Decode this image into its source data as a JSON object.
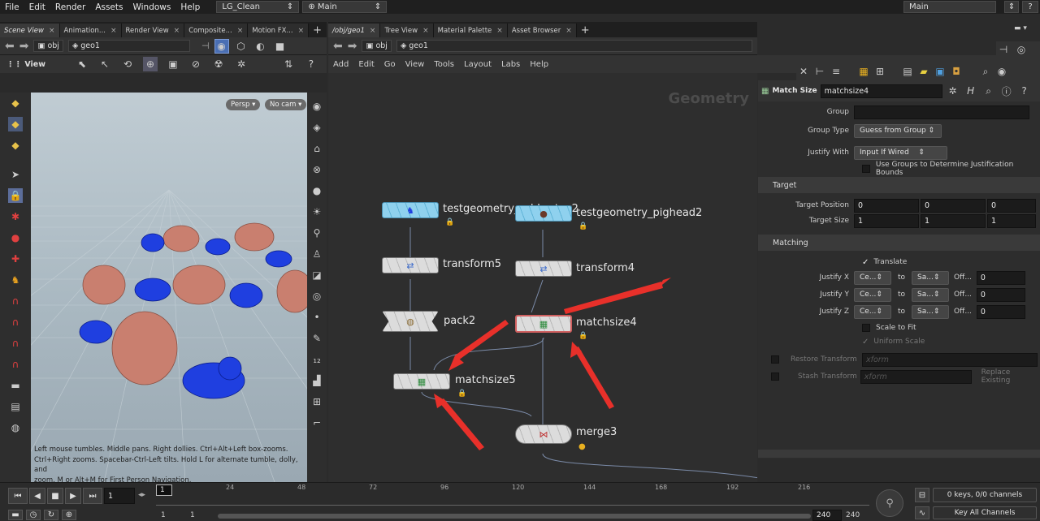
{
  "menubar": {
    "items": [
      "File",
      "Edit",
      "Render",
      "Assets",
      "Windows",
      "Help"
    ],
    "desktop": "LG_Clean",
    "context": "Main",
    "right_desktop": "Main"
  },
  "left_pane": {
    "tabs": [
      "Scene View",
      "Animation...",
      "Render View",
      "Composite...",
      "Motion FX..."
    ],
    "path": [
      "obj",
      "geo1"
    ],
    "view_label": "View",
    "persp": "Persp",
    "cam": "No cam",
    "hint_lines": [
      "Left mouse tumbles. Middle pans. Right dollies. Ctrl+Alt+Left box-zooms.",
      "Ctrl+Right zooms. Spacebar-Ctrl-Left tilts. Hold L for alternate tumble, dolly, and",
      "zoom.    M or Alt+M for First Person Navigation."
    ]
  },
  "mid_pane": {
    "tabs": [
      "/obj/geo1",
      "Tree View",
      "Material Palette",
      "Asset Browser"
    ],
    "path": [
      "obj",
      "geo1"
    ],
    "menu": [
      "Add",
      "Edit",
      "Go",
      "View",
      "Tools",
      "Layout",
      "Labs",
      "Help"
    ],
    "watermark": "Geometry",
    "nodes": {
      "n1": "testgeometry_rubbertoy2",
      "n2": "testgeometry_pighead2",
      "n3": "transform5",
      "n4": "transform4",
      "n5": "pack2",
      "n6": "matchsize4",
      "n7": "matchsize5",
      "n8": "merge3"
    }
  },
  "params": {
    "node_type": "Match Size",
    "node_name": "matchsize4",
    "group_label": "Group",
    "group_value": "",
    "group_type_label": "Group Type",
    "group_type_value": "Guess from Group",
    "justify_with_label": "Justify With",
    "justify_with_value": "Input If Wired",
    "use_groups_label": "Use Groups to Determine Justification Bounds",
    "target_header": "Target",
    "target_pos_label": "Target Position",
    "target_pos": [
      "0",
      "0",
      "0"
    ],
    "target_size_label": "Target Size",
    "target_size": [
      "1",
      "1",
      "1"
    ],
    "matching_header": "Matching",
    "translate_label": "Translate",
    "jx_label": "Justify X",
    "jy_label": "Justify Y",
    "jz_label": "Justify Z",
    "j_a": "Ce...",
    "j_to": "to",
    "j_b": "Sa...",
    "j_off": "Off...",
    "j_val": "0",
    "scale_fit": "Scale to Fit",
    "uniform": "Uniform Scale",
    "restore": "Restore Transform",
    "restore_val": "xform",
    "stash": "Stash Transform",
    "stash_val": "xform",
    "replace": "Replace Existing"
  },
  "timeline": {
    "frame": "1",
    "start_marker": "1",
    "ticks": [
      "24",
      "48",
      "72",
      "96",
      "120",
      "144",
      "168",
      "192",
      "216"
    ],
    "range_start": "1",
    "range_start2": "1",
    "range_end": "240",
    "range_end2": "240",
    "keys_info": "0 keys, 0/0 channels",
    "key_all": "Key All Channels"
  },
  "colors": {
    "accent_red": "#e8302a",
    "node_blue": "#8fd1ee",
    "pig": "#c97f6f",
    "toy": "#1f3fe0"
  }
}
